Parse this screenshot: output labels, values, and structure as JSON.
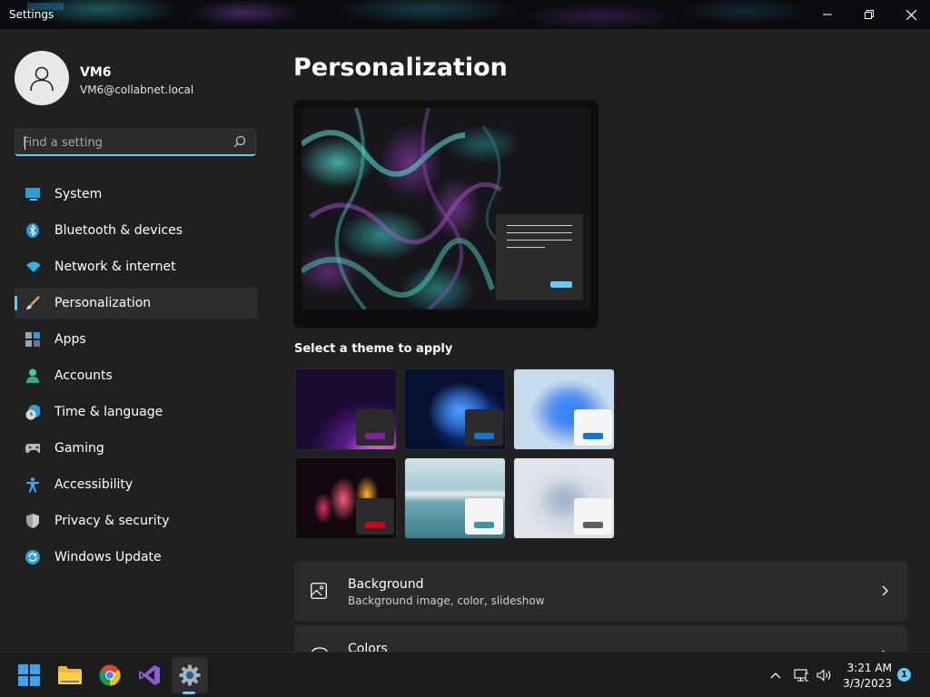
{
  "window": {
    "title": "Settings",
    "controls": {
      "minimize": "minimize",
      "maximize": "restore",
      "close": "close"
    }
  },
  "user": {
    "name": "VM6",
    "email": "VM6@collabnet.local"
  },
  "search": {
    "placeholder": "Find a setting",
    "value": ""
  },
  "sidebar": {
    "items": [
      {
        "label": "System",
        "icon": "monitor-icon",
        "active": false
      },
      {
        "label": "Bluetooth & devices",
        "icon": "bluetooth-icon",
        "active": false
      },
      {
        "label": "Network & internet",
        "icon": "wifi-icon",
        "active": false
      },
      {
        "label": "Personalization",
        "icon": "brush-icon",
        "active": true
      },
      {
        "label": "Apps",
        "icon": "apps-icon",
        "active": false
      },
      {
        "label": "Accounts",
        "icon": "person-icon",
        "active": false
      },
      {
        "label": "Time & language",
        "icon": "clock-globe-icon",
        "active": false
      },
      {
        "label": "Gaming",
        "icon": "gamepad-icon",
        "active": false
      },
      {
        "label": "Accessibility",
        "icon": "accessibility-icon",
        "active": false
      },
      {
        "label": "Privacy & security",
        "icon": "shield-icon",
        "active": false
      },
      {
        "label": "Windows Update",
        "icon": "update-icon",
        "active": false
      }
    ]
  },
  "main": {
    "title": "Personalization",
    "theme_section_label": "Select a theme to apply",
    "themes": [
      {
        "name": "theme-glow",
        "accent": "#7a1fa2"
      },
      {
        "name": "theme-windows-dark",
        "accent": "#0a78d4"
      },
      {
        "name": "theme-windows-light",
        "accent": "#0a78d4"
      },
      {
        "name": "theme-captured-motion",
        "accent": "#d0021b"
      },
      {
        "name": "theme-flow",
        "accent": "#3a96a6"
      },
      {
        "name": "theme-sunrise",
        "accent": "#5a5e66"
      }
    ],
    "cards": [
      {
        "title": "Background",
        "subtitle": "Background image, color, slideshow",
        "icon": "image-icon"
      },
      {
        "title": "Colors",
        "subtitle": "",
        "icon": "palette-icon"
      }
    ]
  },
  "taskbar": {
    "apps": [
      "start-icon",
      "file-explorer-icon",
      "chrome-icon",
      "visual-studio-icon",
      "settings-icon"
    ],
    "clock": {
      "time": "3:21 AM",
      "date": "3/3/2023"
    },
    "notification_count": "1"
  },
  "colors": {
    "accent": "#60cdff",
    "background": "#202020",
    "card": "#2b2b2b"
  }
}
